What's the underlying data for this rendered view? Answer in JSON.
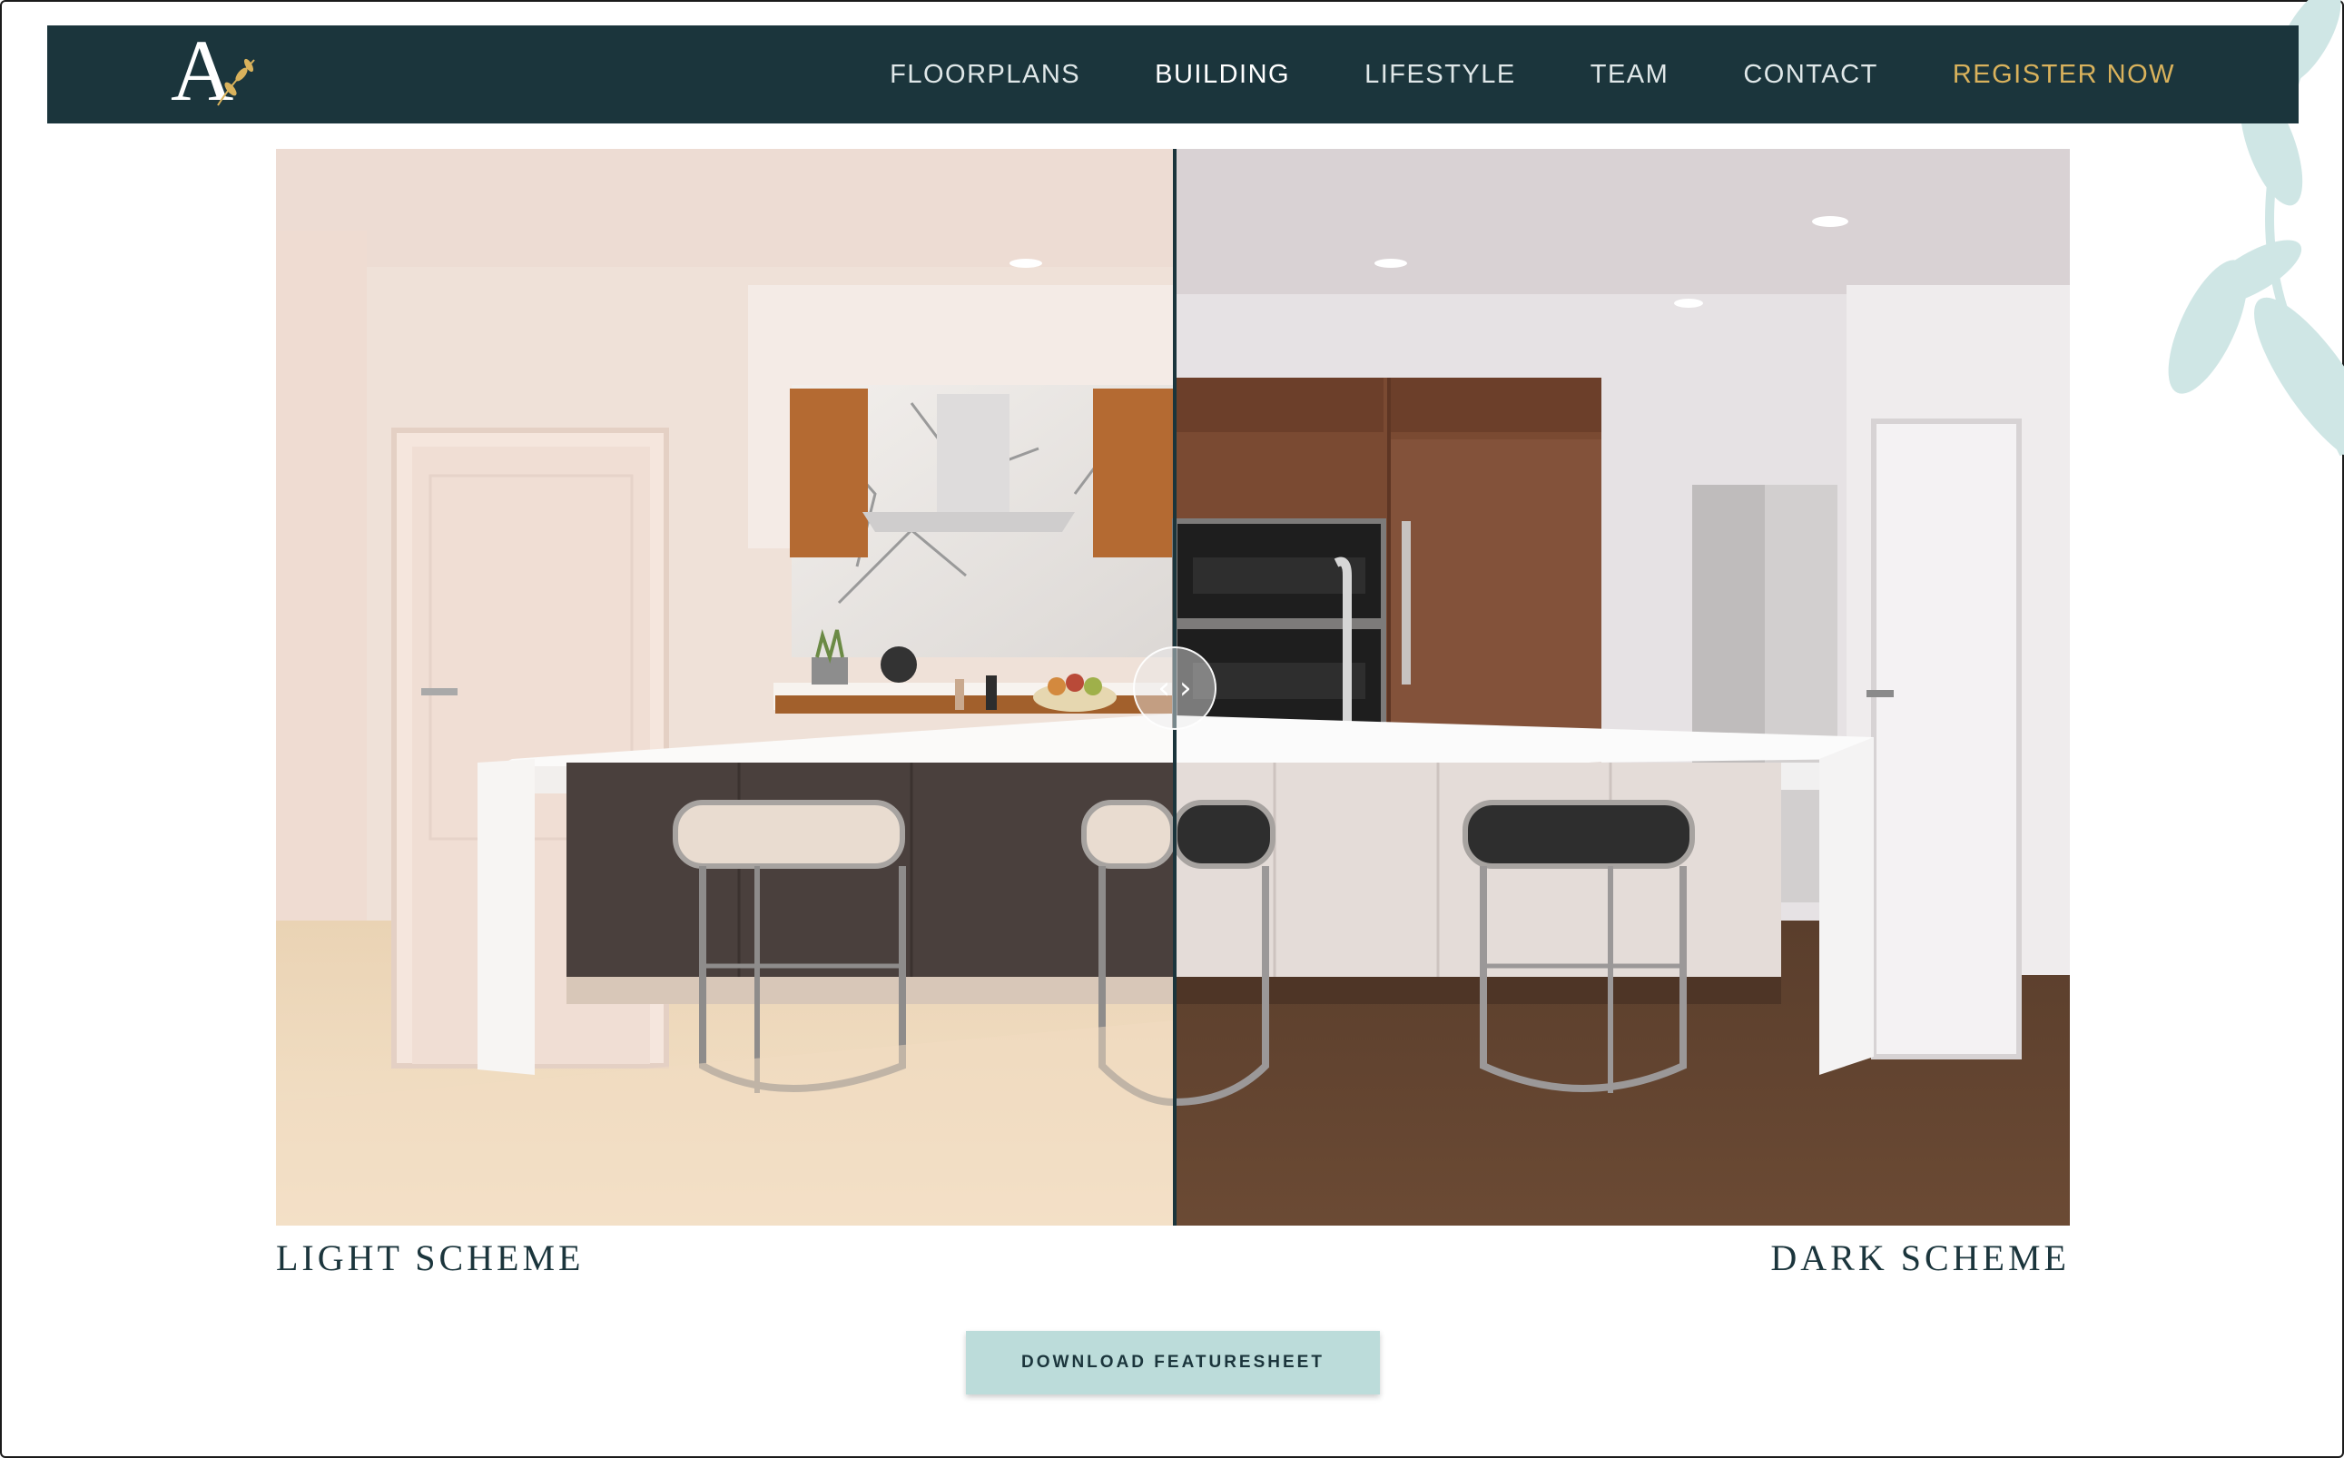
{
  "brand": {
    "logo_letter": "A"
  },
  "nav": {
    "items": [
      {
        "label": "FLOORPLANS"
      },
      {
        "label": "BUILDING"
      },
      {
        "label": "LIFESTYLE"
      },
      {
        "label": "TEAM"
      },
      {
        "label": "CONTACT"
      },
      {
        "label": "REGISTER NOW"
      }
    ],
    "active": "BUILDING"
  },
  "compare": {
    "left_label": "LIGHT SCHEME",
    "right_label": "DARK SCHEME",
    "slider_position": 0.5,
    "handle_left_icon": "‹",
    "handle_right_icon": "›"
  },
  "cta": {
    "download_label": "DOWNLOAD FEATURESHEET"
  },
  "colors": {
    "nav_bg": "#1b353c",
    "register_accent": "#d9b25c",
    "button_bg": "#bcdcda",
    "leaf_deco": "#cfe6e5"
  }
}
